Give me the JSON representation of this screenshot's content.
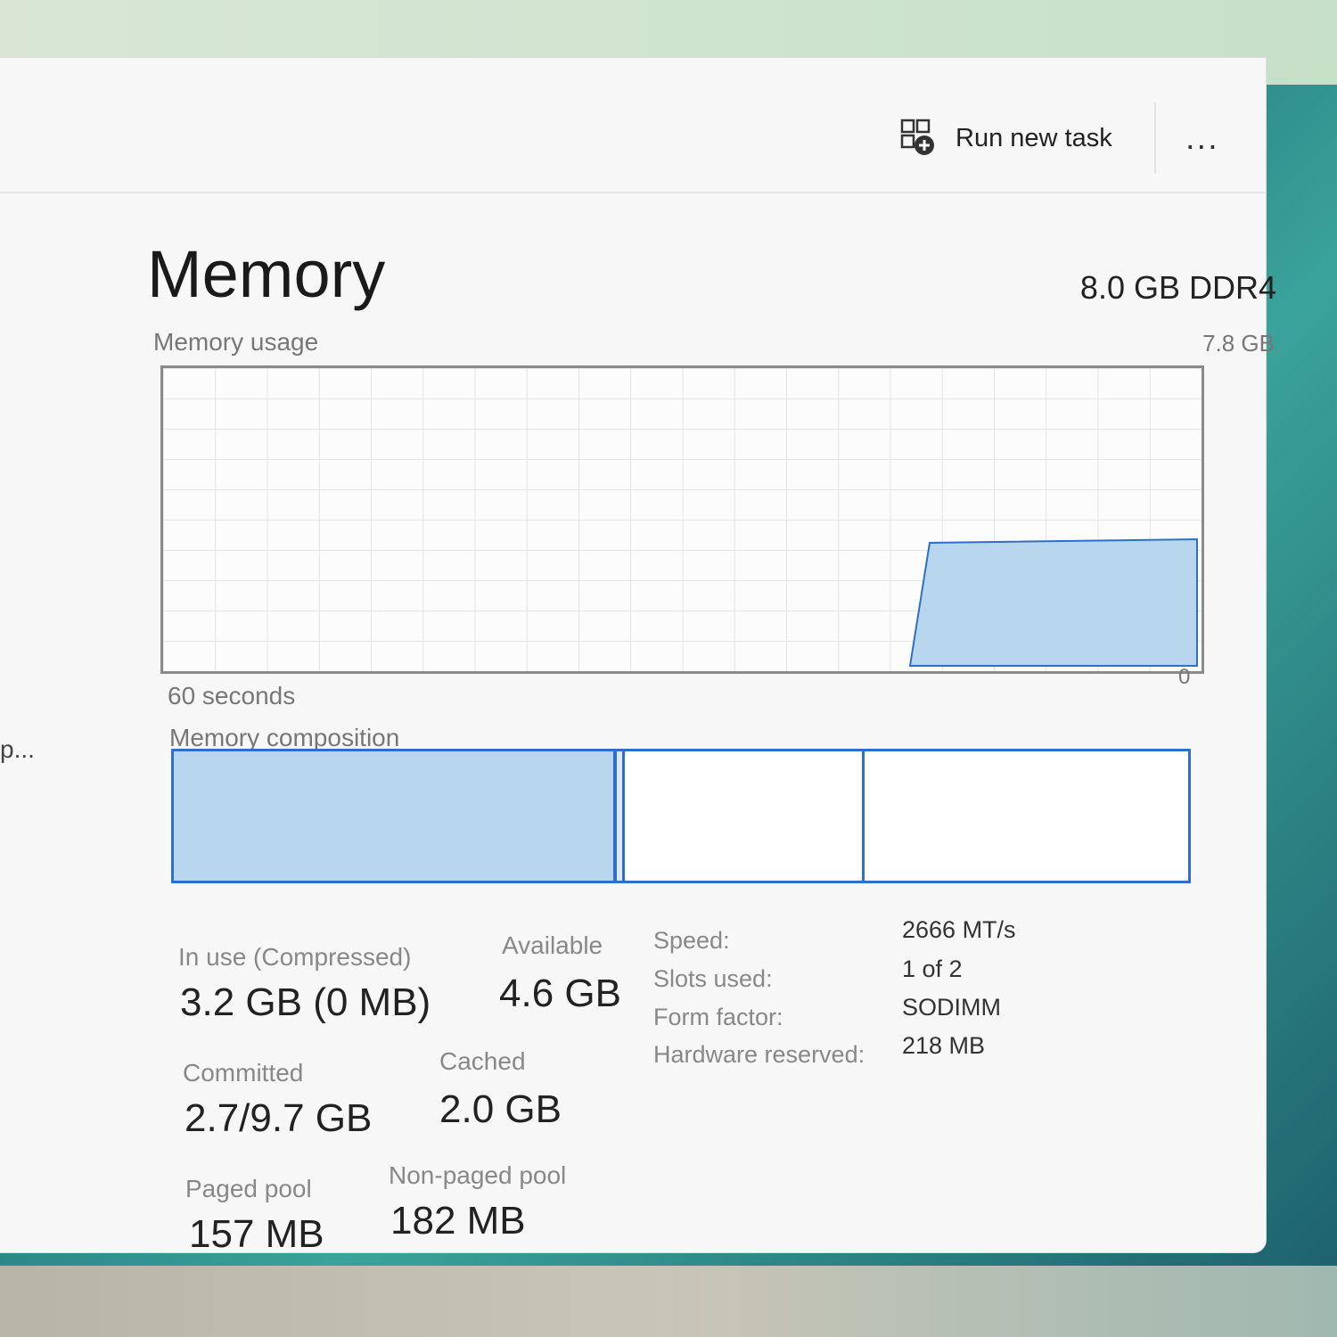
{
  "toolbar": {
    "run_new_task_label": "Run new task",
    "more_label": "...",
    "sidebar_truncated": "p..."
  },
  "header": {
    "title": "Memory",
    "ram_spec": "8.0 GB DDR4"
  },
  "usage_graph": {
    "label": "Memory usage",
    "max_label": "7.8 GB",
    "time_label": "60 seconds",
    "min_label": "0",
    "fill_color": "#b8d7ee",
    "line_color": "#2f6fc9"
  },
  "composition": {
    "label": "Memory composition",
    "colors": {
      "in_use": "#b8d7ee",
      "border": "#2f6fc9"
    }
  },
  "stats": {
    "in_use_label": "In use (Compressed)",
    "in_use_value": "3.2 GB (0 MB)",
    "available_label": "Available",
    "available_value": "4.6 GB",
    "committed_label": "Committed",
    "committed_value": "2.7/9.7 GB",
    "cached_label": "Cached",
    "cached_value": "2.0 GB",
    "paged_pool_label": "Paged pool",
    "paged_pool_value": "157 MB",
    "non_paged_pool_label": "Non-paged pool",
    "non_paged_pool_value": "182 MB"
  },
  "specs": {
    "speed_label": "Speed:",
    "speed_value": "2666 MT/s",
    "slots_label": "Slots used:",
    "slots_value": "1 of 2",
    "form_factor_label": "Form factor:",
    "form_factor_value": "SODIMM",
    "hw_reserved_label": "Hardware reserved:",
    "hw_reserved_value": "218 MB"
  }
}
